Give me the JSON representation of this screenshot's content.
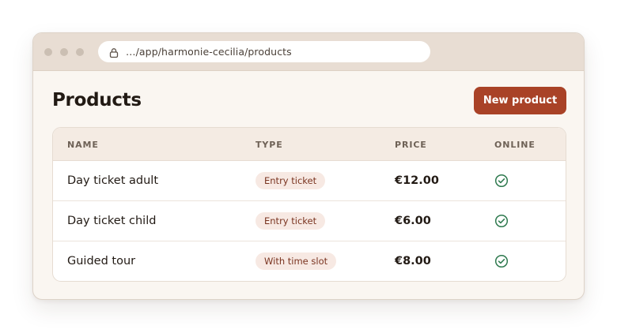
{
  "browser": {
    "url": "…/app/harmonie-cecilia/products"
  },
  "page": {
    "title": "Products",
    "new_button_label": "New product"
  },
  "table": {
    "headers": {
      "name": "NAME",
      "type": "TYPE",
      "price": "PRICE",
      "online": "ONLINE"
    },
    "rows": [
      {
        "name": "Day ticket adult",
        "type": "Entry ticket",
        "price": "€12.00",
        "online": true
      },
      {
        "name": "Day ticket child",
        "type": "Entry ticket",
        "price": "€6.00",
        "online": true
      },
      {
        "name": "Guided tour",
        "type": "With time slot",
        "price": "€8.00",
        "online": true
      }
    ]
  },
  "icons": {
    "lock": "lock-icon",
    "online": "check-circle-icon"
  },
  "colors": {
    "accent": "#a94227",
    "online_check": "#2f7a4f",
    "badge_bg": "#f7e9e3",
    "badge_text": "#7a3420"
  }
}
